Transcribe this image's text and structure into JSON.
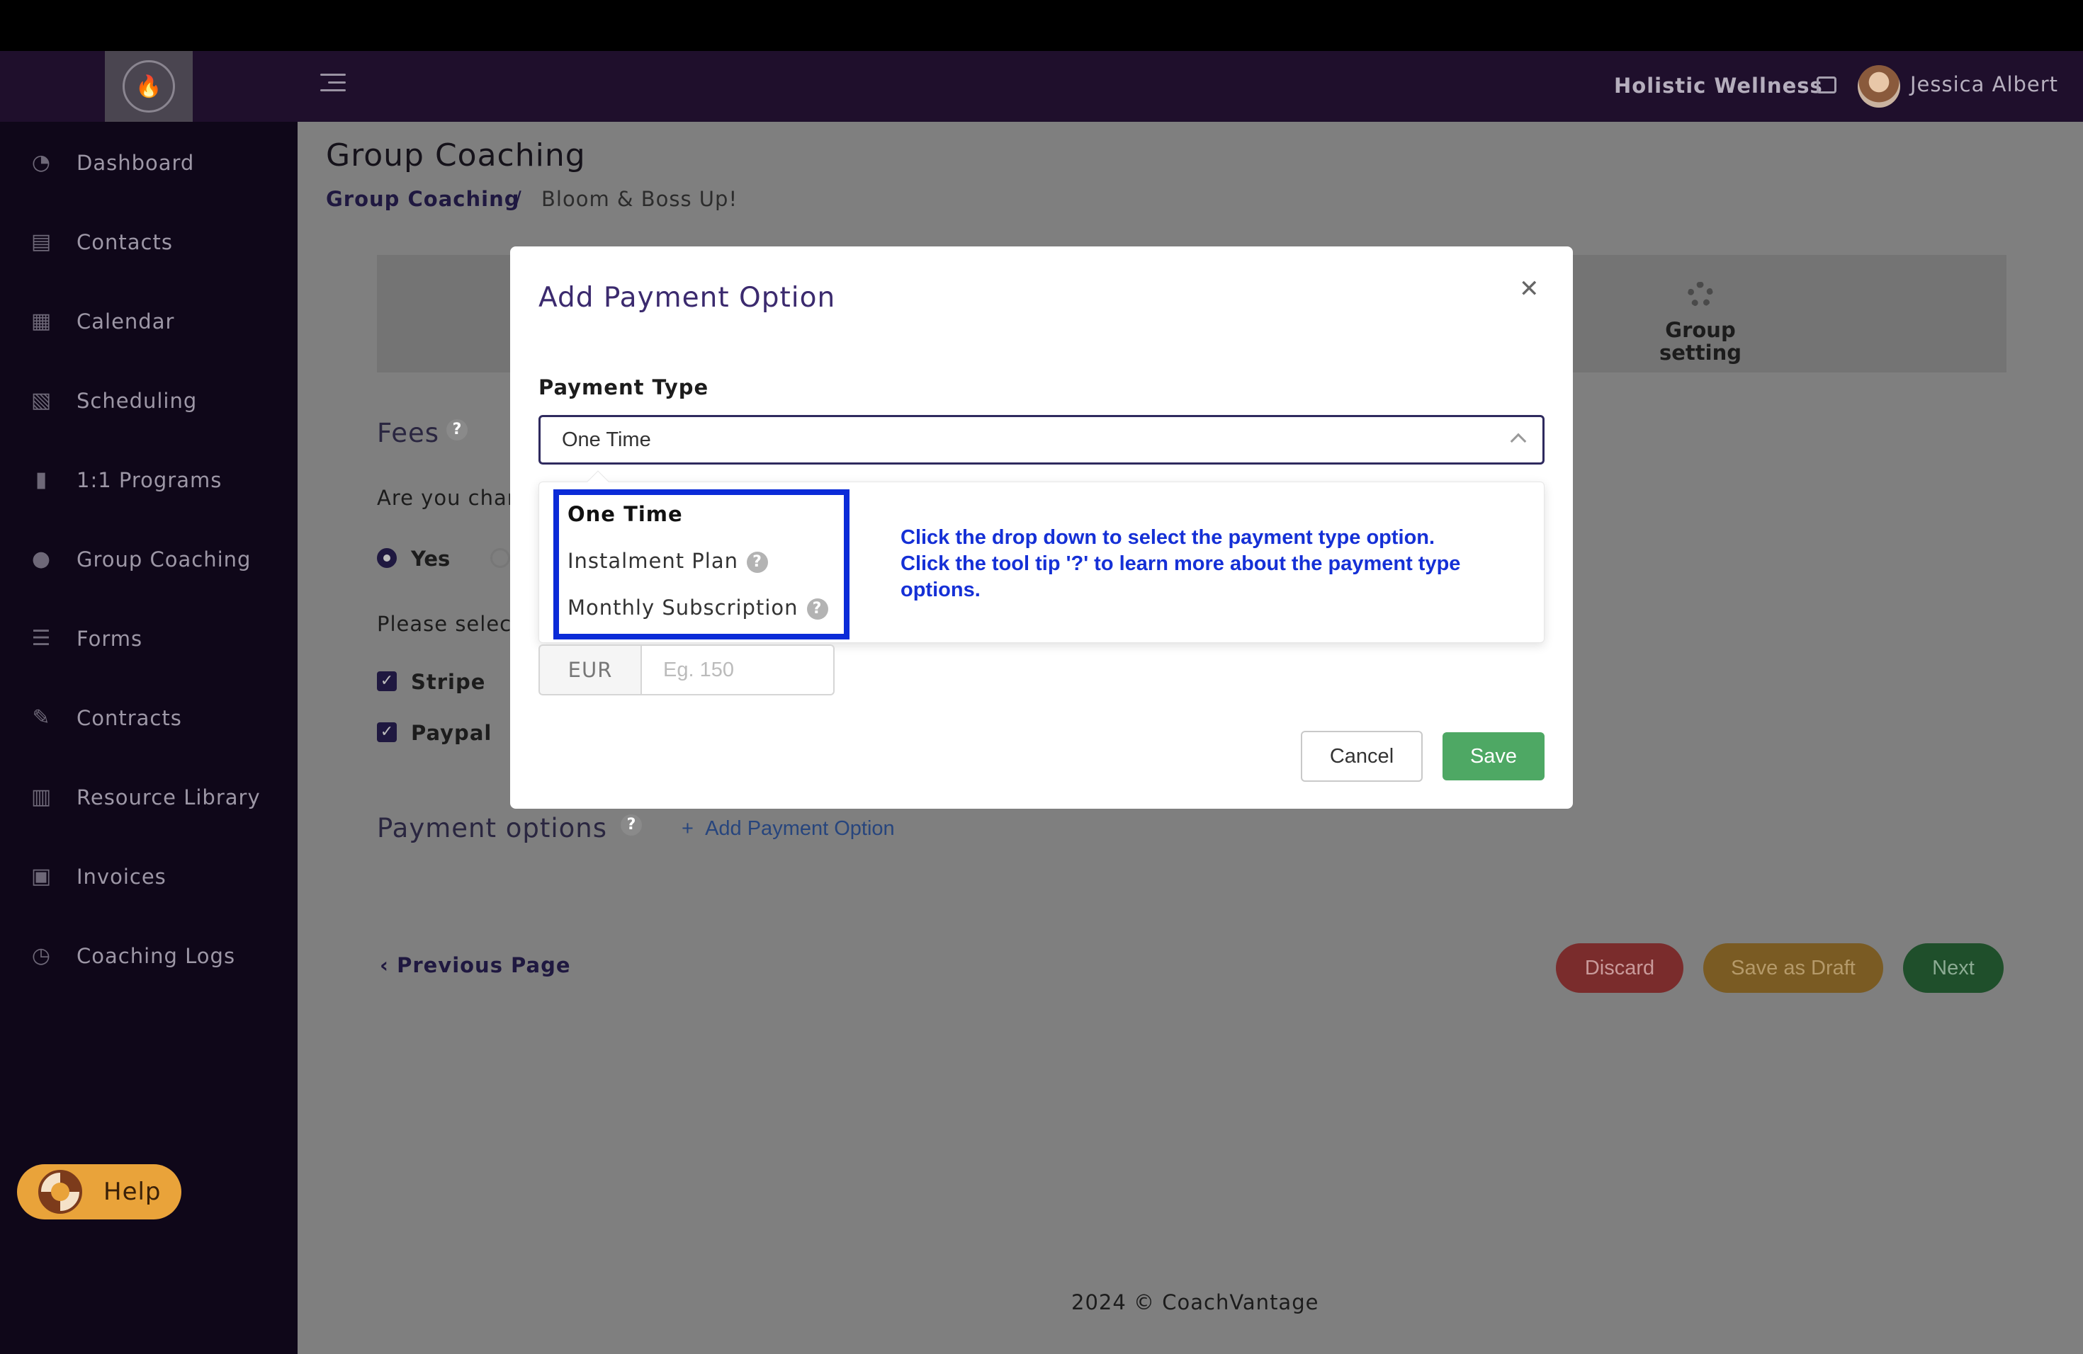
{
  "header": {
    "business_name": "Holistic Wellness",
    "user_name": "Jessica Albert"
  },
  "sidebar": {
    "items": [
      {
        "label": "Dashboard",
        "icon": "dashboard-icon"
      },
      {
        "label": "Contacts",
        "icon": "contacts-icon"
      },
      {
        "label": "Calendar",
        "icon": "calendar-icon"
      },
      {
        "label": "Scheduling",
        "icon": "scheduling-icon"
      },
      {
        "label": "1:1 Programs",
        "icon": "book-icon"
      },
      {
        "label": "Group Coaching",
        "icon": "group-icon"
      },
      {
        "label": "Forms",
        "icon": "forms-icon"
      },
      {
        "label": "Contracts",
        "icon": "contract-icon"
      },
      {
        "label": "Resource Library",
        "icon": "library-icon"
      },
      {
        "label": "Invoices",
        "icon": "invoice-icon"
      },
      {
        "label": "Coaching Logs",
        "icon": "clock-icon"
      }
    ],
    "help_label": "Help"
  },
  "main": {
    "title": "Group Coaching",
    "breadcrumb": [
      "Group Coaching",
      "/",
      "Bloom & Boss Up!"
    ],
    "step_label": "Group setting",
    "fees_title": "Fees",
    "charge_question": "Are you char",
    "radio_yes": "Yes",
    "please_select": "Please select",
    "gateways": [
      "Stripe",
      "Paypal"
    ],
    "payment_options_title": "Payment options",
    "add_payment_option": "Add Payment Option",
    "previous_page": "Previous Page",
    "discard": "Discard",
    "save_as_draft": "Save as Draft",
    "next": "Next",
    "footer": "2024 © CoachVantage"
  },
  "modal": {
    "title": "Add Payment Option",
    "payment_type_label": "Payment Type",
    "selected_value": "One Time",
    "options": [
      "One Time",
      "Instalment Plan",
      "Monthly Subscription"
    ],
    "tip_line1": "Click the drop down to select the payment type option.",
    "tip_line2": "Click the tool tip '?' to learn more about the payment type options.",
    "currency": "EUR",
    "amount_placeholder": "Eg. 150",
    "cancel": "Cancel",
    "save": "Save"
  },
  "colors": {
    "header_bg": "#1f0f2c",
    "sidebar_bg": "#0f0719",
    "overlay": "#7f7f7f",
    "highlight": "#0b2bd8",
    "tip_text": "#1530d6",
    "save_green": "#4ea864",
    "help_orange": "#e9a33a"
  }
}
